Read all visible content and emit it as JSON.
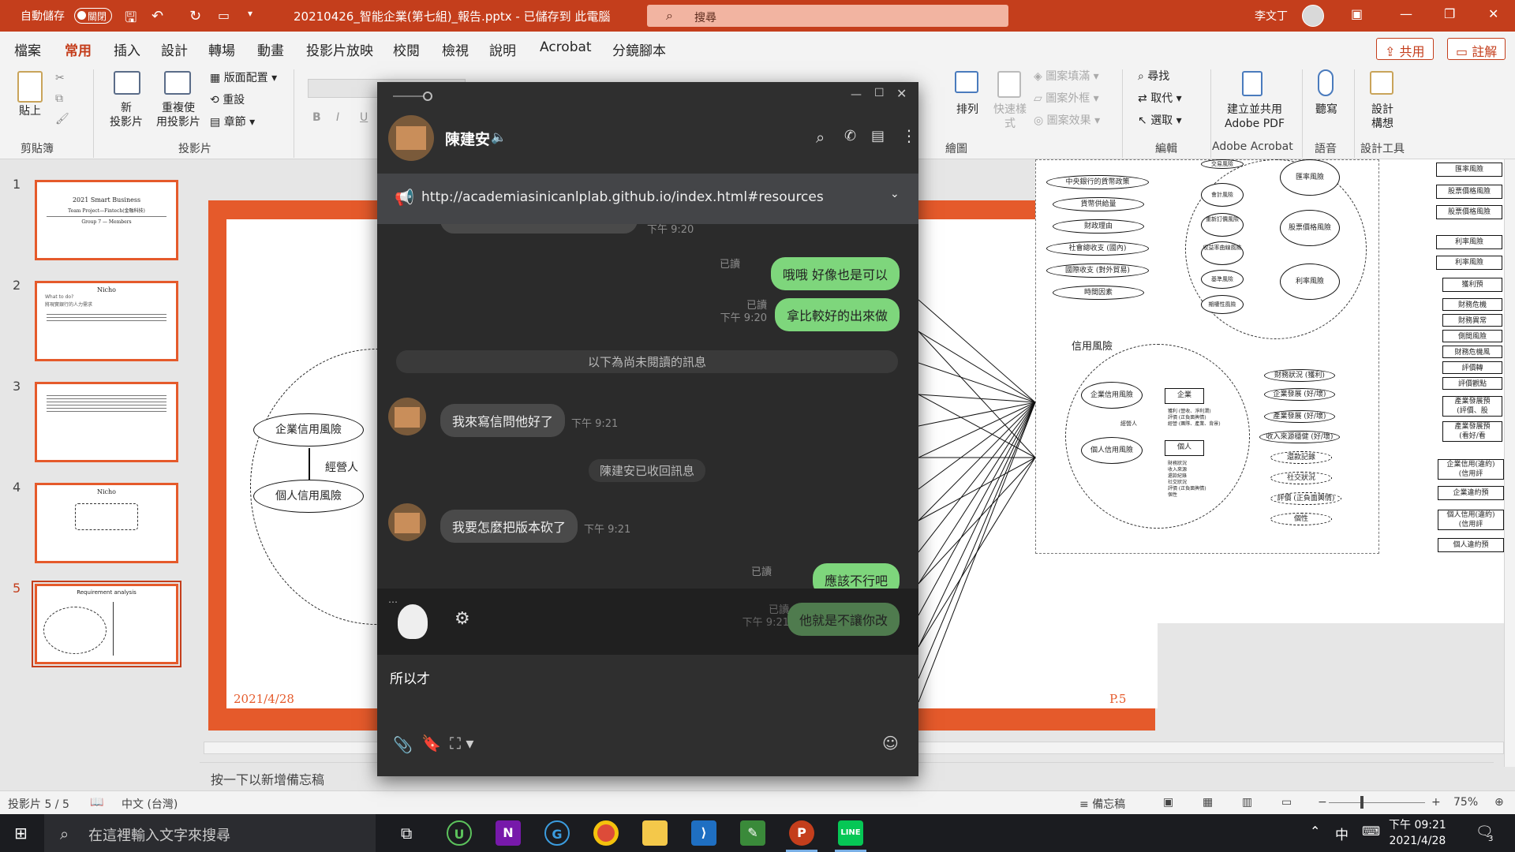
{
  "title_bar": {
    "autosave_label": "自動儲存",
    "autosave_state": "關閉",
    "document_title": "20210426_智能企業(第七組)_報告.pptx - 已儲存到 此電腦",
    "search_placeholder": "搜尋",
    "user_name": "李文丁"
  },
  "ribbon_tabs": [
    "檔案",
    "常用",
    "插入",
    "設計",
    "轉場",
    "動畫",
    "投影片放映",
    "校閱",
    "檢視",
    "說明",
    "Acrobat",
    "分鏡腳本"
  ],
  "active_tab": "常用",
  "share_label": "共用",
  "comment_label": "註解",
  "ribbon": {
    "clipboard": {
      "paste": "貼上",
      "group": "剪貼簿"
    },
    "slides": {
      "new_slide": "新\n投影片",
      "reuse": "重複使\n用投影片",
      "layout": "版面配置",
      "reset": "重設",
      "section": "章節",
      "group": "投影片"
    },
    "arrange": {
      "arrange": "排列",
      "quick_styles": "快速樣\n式",
      "fill": "圖案填滿",
      "outline": "圖案外框",
      "effects": "圖案效果",
      "group": "繪圖"
    },
    "editing": {
      "find": "尋找",
      "replace": "取代",
      "select": "選取",
      "group": "編輯"
    },
    "acrobat": {
      "create": "建立並共用\nAdobe PDF",
      "group": "Adobe Acrobat"
    },
    "voice": {
      "dictate": "聽寫",
      "group": "語音"
    },
    "designer": {
      "ideas": "設計\n構想",
      "group": "設計工具"
    }
  },
  "thumbnails": [
    {
      "num": "1",
      "title": "2021 Smart Business",
      "sub": "Team Project—Fintech(金融科技)",
      "line3": "Group 7 — Members"
    },
    {
      "num": "2",
      "title": "Nicho",
      "sub": "What to do?",
      "line3": "將現實銀行的人力需求"
    },
    {
      "num": "3",
      "title": "",
      "sub": "",
      "line3": ""
    },
    {
      "num": "4",
      "title": "Nicho",
      "sub": "",
      "line3": ""
    },
    {
      "num": "5",
      "title": "Requirement analysis",
      "sub": "",
      "line3": ""
    }
  ],
  "slide": {
    "date": "2021/4/28",
    "page": "P.5",
    "nodes_left": [
      "企業信用風險",
      "經營人",
      "個人信用風險"
    ],
    "right": {
      "macro": [
        "中央銀行的貨幣政策",
        "貨幣供給量",
        "財政理由",
        "社會總收支 (國內)",
        "國際收支 (對外貿易)",
        "時間因素"
      ],
      "market": [
        "匯率風險",
        "股票價格風險",
        "利率風險"
      ],
      "small": [
        "交易風險",
        "會計風險",
        "重新訂價風險",
        "收益率曲線風險",
        "基準風險",
        "期權性風險"
      ],
      "credit_title": "信用風險",
      "credit": [
        "企業信用風險",
        "經營人",
        "個人信用風險"
      ],
      "entity": [
        "企業",
        "個人"
      ],
      "ent_items": "獲利 (營收、淨利潤)\n評價 (正負面輿情)\n經營 (團隊、產業、背景)",
      "ind_items": "財務狀況\n收入來源\n還款紀錄\n社交狀況\n評價 (正負面輿情)\n個性",
      "factors": [
        "財務狀況 (獲利)",
        "企業發展 (好/壞)",
        "產業發展 (好/壞)",
        "收入來源穩健 (好/壞)",
        "還款記錄",
        "社交狀況",
        "評價 (正負面輿情)",
        "個性"
      ],
      "far_right": [
        "匯率風險",
        "股票價格風險",
        "股票價格風險",
        "利率風險",
        "利率風險",
        "獲利預",
        "財務危機",
        "財務異常",
        "側間風險",
        "財務危機風",
        "評價轉",
        "評價觀點",
        "產業發展預\n(評價、股",
        "產業發展預\n(看好/看",
        "企業信用(違約)\n(信用評",
        "企業違約預",
        "個人信用(違約)\n(信用評",
        "個人違約預"
      ]
    }
  },
  "notes_placeholder": "按一下以新增備忘稿",
  "status": {
    "slide_count": "投影片 5 / 5",
    "language": "中文 (台灣)",
    "notes": "備忘稿",
    "zoom": "75%"
  },
  "taskbar": {
    "search": "在這裡輸入文字來搜尋",
    "time": "下午 09:21",
    "date": "2021/4/28",
    "ime": "中",
    "notif": "3"
  },
  "line": {
    "contact": "陳建安",
    "pinned_url": "http://academiasinicanlplab.github.io/index.html#resources",
    "top_time": "下午 9:20",
    "messages": [
      {
        "who": "me",
        "text": "哦哦 好像也是可以",
        "read": "已讀",
        "time": ""
      },
      {
        "who": "me",
        "text": "拿比較好的出來做",
        "read": "已讀",
        "time": "下午 9:20"
      },
      {
        "who": "system",
        "text": "以下為尚未閱讀的訊息"
      },
      {
        "who": "them",
        "text": "我來寫信問他好了",
        "time": "下午 9:21"
      },
      {
        "who": "system",
        "text": "陳建安已收回訊息"
      },
      {
        "who": "them",
        "text": "我要怎麼把版本砍了",
        "time": "下午 9:21"
      },
      {
        "who": "me",
        "text": "應該不行吧",
        "read": "已讀",
        "time": ""
      },
      {
        "who": "me",
        "text": "他就是不讓你改",
        "read": "已讀",
        "time": "下午 9:21"
      }
    ],
    "input_text": "所以才"
  }
}
